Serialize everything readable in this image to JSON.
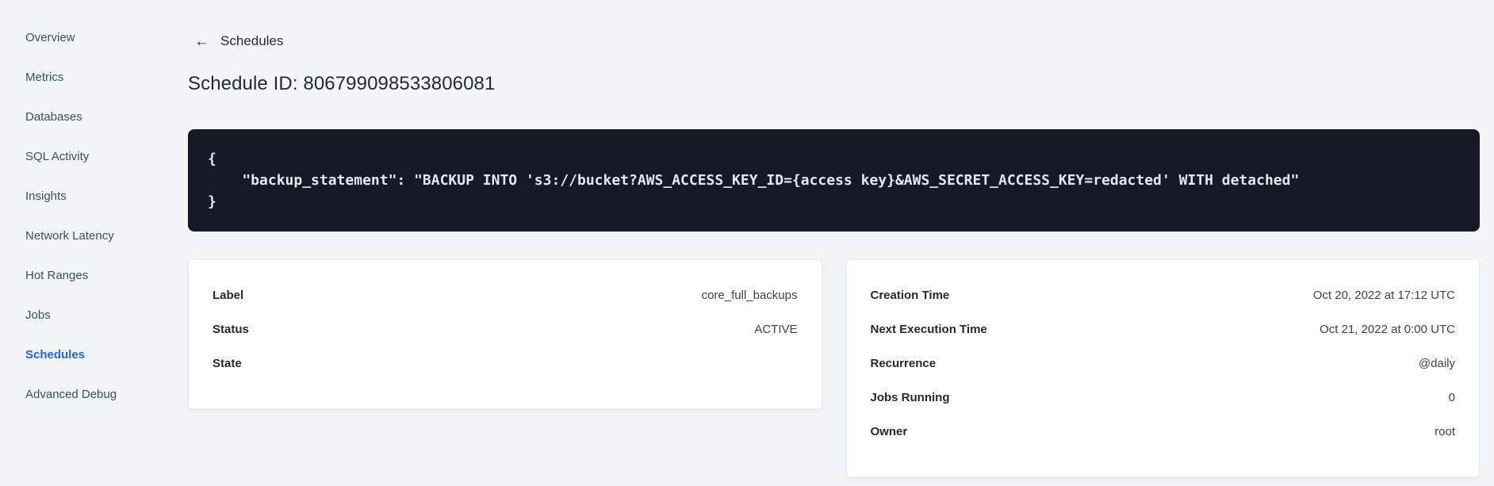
{
  "sidebar": {
    "items": [
      {
        "label": "Overview",
        "active": false
      },
      {
        "label": "Metrics",
        "active": false
      },
      {
        "label": "Databases",
        "active": false
      },
      {
        "label": "SQL Activity",
        "active": false
      },
      {
        "label": "Insights",
        "active": false
      },
      {
        "label": "Network Latency",
        "active": false
      },
      {
        "label": "Hot Ranges",
        "active": false
      },
      {
        "label": "Jobs",
        "active": false
      },
      {
        "label": "Schedules",
        "active": true
      },
      {
        "label": "Advanced Debug",
        "active": false
      }
    ]
  },
  "header": {
    "back_icon": "←",
    "back_label": "Schedules",
    "title": "Schedule ID: 806799098533806081"
  },
  "code_block": {
    "lines": [
      "{",
      "    \"backup_statement\": \"BACKUP INTO 's3://bucket?AWS_ACCESS_KEY_ID={access key}&AWS_SECRET_ACCESS_KEY=redacted' WITH detached\"",
      "}"
    ]
  },
  "cards": {
    "left": {
      "rows": [
        {
          "label": "Label",
          "value": "core_full_backups"
        },
        {
          "label": "Status",
          "value": "ACTIVE"
        },
        {
          "label": "State",
          "value": ""
        }
      ]
    },
    "right": {
      "rows": [
        {
          "label": "Creation Time",
          "value": "Oct 20, 2022 at 17:12 UTC"
        },
        {
          "label": "Next Execution Time",
          "value": "Oct 21, 2022 at 0:00 UTC"
        },
        {
          "label": "Recurrence",
          "value": "@daily"
        },
        {
          "label": "Jobs Running",
          "value": "0"
        },
        {
          "label": "Owner",
          "value": "root"
        }
      ]
    }
  },
  "colors": {
    "accent_blue": "#2563eb",
    "code_background": "#151a26",
    "page_background": "#f1f5f8"
  }
}
